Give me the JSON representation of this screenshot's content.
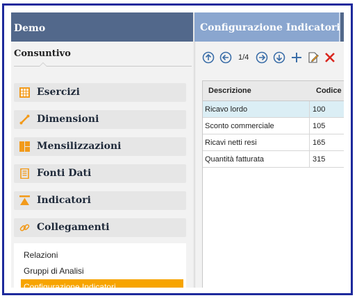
{
  "header": {
    "left_title": "Demo",
    "right_tab": "Configurazione Indicatori"
  },
  "sidebar": {
    "section_title": "Consuntivo",
    "items": [
      {
        "label": "Esercizi",
        "icon": "grid-icon",
        "color": "#f29a1a"
      },
      {
        "label": "Dimensioni",
        "icon": "measure-icon",
        "color": "#f29a1a"
      },
      {
        "label": "Mensilizzazioni",
        "icon": "layout-icon",
        "color": "#f29a1a"
      },
      {
        "label": "Fonti Dati",
        "icon": "document-icon",
        "color": "#f29a1a"
      },
      {
        "label": "Indicatori",
        "icon": "indicator-icon",
        "color": "#f29a1a"
      },
      {
        "label": "Collegamenti",
        "icon": "link-icon",
        "color": "#f29a1a"
      }
    ],
    "sub_items": [
      {
        "label": "Relazioni",
        "active": false
      },
      {
        "label": "Gruppi di Analisi",
        "active": false
      },
      {
        "label": "Configurazione Indicatori",
        "active": true
      }
    ]
  },
  "toolbar": {
    "page_indicator": "1/4",
    "buttons": [
      "first-page-icon",
      "previous-page-icon",
      "next-page-icon",
      "last-page-icon",
      "add-icon",
      "edit-icon",
      "delete-icon"
    ]
  },
  "grid": {
    "columns": [
      "Descrizione",
      "Codice"
    ],
    "rows": [
      {
        "descrizione": "Ricavo lordo",
        "codice": "100",
        "selected": true
      },
      {
        "descrizione": "Sconto commerciale",
        "codice": "105",
        "selected": false
      },
      {
        "descrizione": "Ricavi netti resi",
        "codice": "165",
        "selected": false
      },
      {
        "descrizione": "Quantità fatturata",
        "codice": "315",
        "selected": false
      }
    ]
  },
  "colors": {
    "frame": "#1e2a9c",
    "header": "#52688b",
    "active_tab": "#8aa6cf",
    "accent": "#f7a400",
    "toolbar_icon": "#3b6ea8",
    "delete": "#d9251d"
  }
}
